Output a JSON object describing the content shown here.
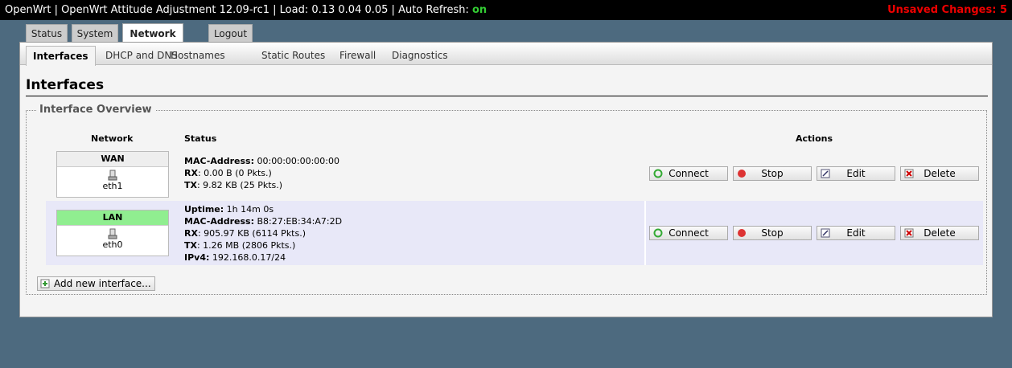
{
  "topbar": {
    "title_prefix": "OpenWrt | OpenWrt Attitude Adjustment 12.09-rc1 | Load: 0.13 0.04 0.05 | Auto Refresh: ",
    "auto_refresh": "on",
    "unsaved": "Unsaved Changes: 5"
  },
  "main_tabs": [
    "Status",
    "System",
    "Network",
    "Logout"
  ],
  "sub_tabs": [
    "Interfaces",
    "DHCP and DNS",
    "Hostnames",
    "Static Routes",
    "Firewall",
    "Diagnostics"
  ],
  "page_title": "Interfaces",
  "overview": {
    "legend": "Interface Overview",
    "col_network": "Network",
    "col_status": "Status",
    "col_actions": "Actions",
    "rows": [
      {
        "name": "WAN",
        "device": "eth1",
        "status": [
          {
            "label": "MAC-Address:",
            "value": " 00:00:00:00:00:00"
          },
          {
            "label": "RX",
            "value": ": 0.00 B (0 Pkts.)"
          },
          {
            "label": "TX",
            "value": ": 9.82 KB (25 Pkts.)"
          }
        ]
      },
      {
        "name": "LAN",
        "device": "eth0",
        "status": [
          {
            "label": "Uptime:",
            "value": " 1h 14m 0s"
          },
          {
            "label": "MAC-Address:",
            "value": " B8:27:EB:34:A7:2D"
          },
          {
            "label": "RX",
            "value": ": 905.97 KB (6114 Pkts.)"
          },
          {
            "label": "TX",
            "value": ": 1.26 MB (2806 Pkts.)"
          },
          {
            "label": "IPv4:",
            "value": " 192.168.0.17/24"
          }
        ]
      }
    ],
    "actions": {
      "connect": "Connect",
      "stop": "Stop",
      "edit": "Edit",
      "delete": "Delete"
    },
    "add_button": "Add new interface..."
  }
}
